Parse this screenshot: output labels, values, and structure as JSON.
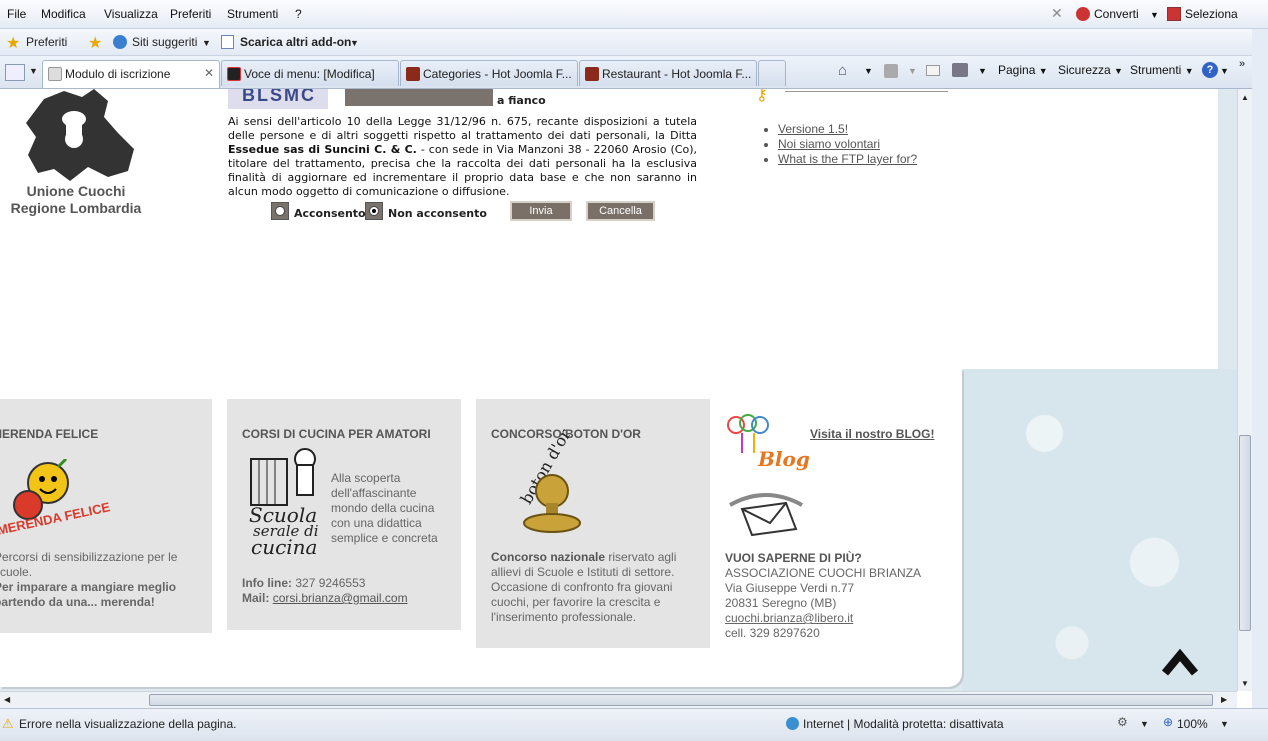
{
  "menu": {
    "items": [
      "File",
      "Modifica",
      "Visualizza",
      "Preferiti",
      "Strumenti",
      "?"
    ],
    "convert": "Converti",
    "select": "Seleziona"
  },
  "favbar": {
    "favorites": "Preferiti",
    "suggested": "Siti suggeriti",
    "addons": "Scarica altri add-on"
  },
  "tabs": [
    {
      "label": "Modulo di iscrizione"
    },
    {
      "label": "Voce di menu: [Modifica]"
    },
    {
      "label": "Categories - Hot Joomla F..."
    },
    {
      "label": "Restaurant - Hot Joomla F..."
    }
  ],
  "commandbar": {
    "page": "Pagina",
    "security": "Sicurezza",
    "tools": "Strumenti"
  },
  "logo": {
    "line1": "Unione Cuochi",
    "line2": "Regione Lombardia"
  },
  "form": {
    "captcha_text": "BLSMC",
    "beside": "a fianco",
    "privacy_1": "Ai sensi dell'articolo 10 della Legge 31/12/96 n. 675, recante disposizioni a tutela delle persone e di altri soggetti rispetto al trattamento dei dati personali, la Ditta ",
    "privacy_company": "Essedue sas di Suncini C. & C.",
    "privacy_2": " - con sede in Via Manzoni 38 - 22060 Arosio (Co), titolare del trattamento, precisa che la raccolta dei dati personali ha la esclusiva finalità di aggiornare ed incrementare il proprio data base e che non saranno in alcun modo oggetto di comunicazione o diffusione.",
    "consent": "Acconsento",
    "no_consent": "Non acconsento",
    "submit": "Invia",
    "cancel": "Cancella"
  },
  "sidelinks": [
    "Versione 1.5!",
    "Noi siamo volontari",
    "What is the FTP layer for?"
  ],
  "box1": {
    "title": "MERENDA FELICE",
    "logo": "MERENDA FELICE",
    "text1": "Percorsi di sensibilizzazione per le scuole.",
    "text2": "Per imparare a mangiare meglio partendo da una... merenda!"
  },
  "box2": {
    "title": "CORSI DI CUCINA PER AMATORI",
    "logo_line1": "Scuola",
    "logo_line2": "serale di",
    "logo_line3": "cucina",
    "desc": "Alla scoperta dell'affascinante mondo della cucina con una didattica semplice e concreta",
    "info_label": "Info line:",
    "info_phone": "327 9246553",
    "mail_label": "Mail:",
    "mail": "corsi.brianza@gmail.com"
  },
  "box3": {
    "title": "CONCORSO BOTON D'OR",
    "logo": "boton d'or",
    "bold": "Concorso nazionale",
    "text": " riservato agli allievi di Scuole e Istituti di settore. Occasione di confronto fra giovani cuochi, per favorire la crescita e l'inserimento professionale."
  },
  "box4": {
    "blog_logo": "Blog",
    "blog_link": "Visita il nostro BLOG!",
    "title": "VUOI SAPERNE DI PIÙ?",
    "assoc": "ASSOCIAZIONE CUOCHI BRIANZA",
    "address": "Via Giuseppe Verdi n.77",
    "city": "20831 Seregno (MB)",
    "email": "cuochi.brianza@libero.it",
    "cell": "cell. 329 8297620"
  },
  "status": {
    "error": "Errore nella visualizzazione della pagina.",
    "zone": "Internet | Modalità protetta: disattivata",
    "zoom": "100%"
  },
  "colors": {
    "button_bg": "#7b7068",
    "box_bg": "#e4e4e4",
    "page_bg": "#dde9ee"
  }
}
